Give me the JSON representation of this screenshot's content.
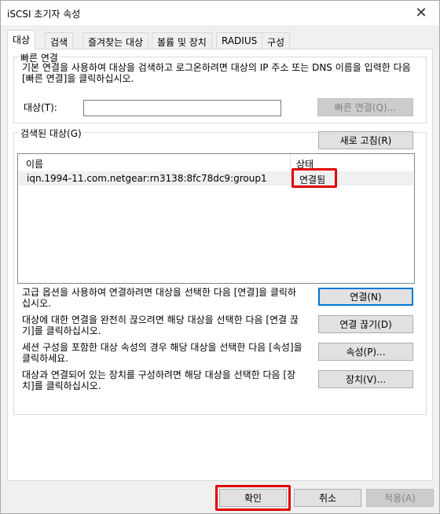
{
  "window": {
    "title": "iSCSI 초기자 속성",
    "close_glyph": "✕"
  },
  "tabs": [
    {
      "label": "대상",
      "active": true
    },
    {
      "label": "검색",
      "active": false
    },
    {
      "label": "즐겨찾는 대상",
      "active": false
    },
    {
      "label": "볼륨 및 장치",
      "active": false
    },
    {
      "label": "RADIUS",
      "active": false
    },
    {
      "label": "구성",
      "active": false
    }
  ],
  "quick_connect": {
    "legend": "빠른 연결",
    "description": "기본 연결을 사용하여 대상을 검색하고 로그온하려면 대상의 IP 주소 또는 DNS 이름을 입력한 다음 [빠른 연결]을 클릭하십시오.",
    "target_label": "대상(T):",
    "target_value": "",
    "button": "빠른 연결(Q)..."
  },
  "discovered": {
    "legend": "검색된 대상(G)",
    "refresh_button": "새로 고침(R)",
    "columns": {
      "name": "이름",
      "status": "상태"
    },
    "rows": [
      {
        "name": "iqn.1994-11.com.netgear:rn3138:8fc78dc9:group1",
        "status": "연결됨"
      }
    ],
    "actions": [
      {
        "text": "고급 옵션을 사용하여 연결하려면 대상을 선택한 다음 [연결]을 클릭하십시오.",
        "button": "연결(N)"
      },
      {
        "text": "대상에 대한 연결을 완전히 끊으려면 해당 대상을 선택한 다음 [연결 끊기]를 클릭하십시오.",
        "button": "연결 끊기(D)"
      },
      {
        "text": "세션 구성을 포함한 대상 속성의 경우 해당 대상을 선택한 다음 [속성]을 클릭하세요.",
        "button": "속성(P)..."
      },
      {
        "text": "대상과 연결되어 있는 장치를 구성하려면 해당 대상을 선택한 다음 [장치]를 클릭하십시오.",
        "button": "장치(V)..."
      }
    ]
  },
  "footer": {
    "ok": "확인",
    "cancel": "취소",
    "apply": "적용(A)"
  },
  "colors": {
    "highlight": "#e00000",
    "default_button_border": "#0078d7"
  }
}
